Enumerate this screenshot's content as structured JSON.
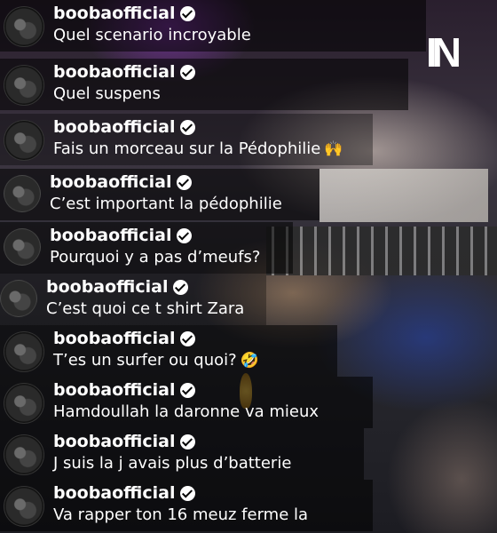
{
  "logo": {
    "text": "IN"
  },
  "comments": [
    {
      "username": "boobaofficial",
      "message": "Quel scenario incroyable",
      "verified": true
    },
    {
      "username": "boobaofficial",
      "message": "Quel suspens",
      "verified": true
    },
    {
      "username": "boobaofficial",
      "message": "Fais un morceau sur la Pédophilie",
      "verified": true,
      "emoji": "🙌"
    },
    {
      "username": "boobaofficial",
      "message": "C’est important la pédophilie",
      "verified": true
    },
    {
      "username": "boobaofficial",
      "message": "Pourquoi y a pas d’meufs?",
      "verified": true
    },
    {
      "username": "boobaofficial",
      "message": "C’est quoi ce t shirt Zara",
      "verified": true
    },
    {
      "username": "boobaofficial",
      "message": "T’es un surfer ou quoi?",
      "verified": true,
      "emoji": "🤣"
    },
    {
      "username": "boobaofficial",
      "message": "Hamdoullah la daronne va mieux",
      "verified": true
    },
    {
      "username": "boobaofficial",
      "message": "J suis la j avais plus d’batterie",
      "verified": true
    },
    {
      "username": "boobaofficial",
      "message": "Va rapper ton 16 meuz ferme la",
      "verified": true
    }
  ]
}
